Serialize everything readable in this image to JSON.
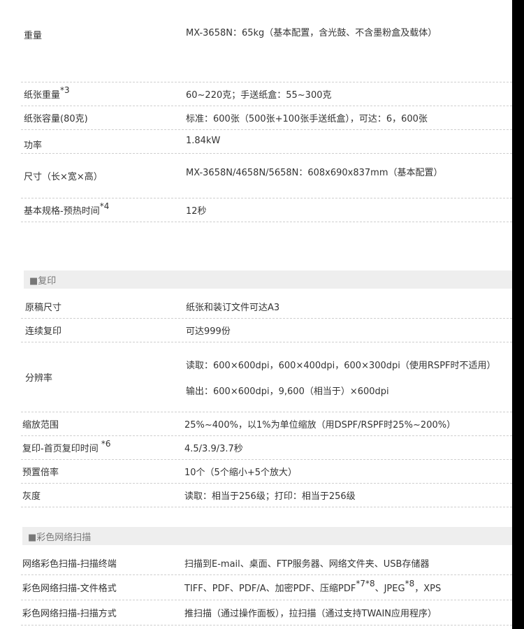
{
  "specs_top": [
    {
      "label": "重量",
      "value": "MX-3658N：65kg（基本配置，含光鼓、不含墨粉盒及载体）"
    },
    {
      "label": "纸张重量",
      "label_sup": "*3",
      "value": "60~220克；手送纸盒：55~300克"
    },
    {
      "label": "纸张容量(80克)",
      "value": "标准：600张（500张+100张手送纸盒），可达：6，600张"
    },
    {
      "label": "功率",
      "value": "1.84kW"
    },
    {
      "label": "尺寸（长×宽×高）",
      "value": "MX-3658N/4658N/5658N：608x690x837mm（基本配置）"
    },
    {
      "label": "基本规格-预热时间",
      "label_sup": "*4",
      "value": "12秒"
    }
  ],
  "section_copy": "■复印",
  "specs_copy": [
    {
      "label": "原稿尺寸",
      "value": "纸张和装订文件可达A3"
    },
    {
      "label": "连续复印",
      "value": "可达999份"
    },
    {
      "label": "分辨率",
      "value_lines": [
        "读取：600×600dpi，600×400dpi，600×300dpi（使用RSPF时不适用）",
        "输出：600×600dpi，9,600（相当于）×600dpi"
      ]
    },
    {
      "label": "缩放范围",
      "value": "25%~400%，以1%为单位缩放（用DSPF/RSPF时25%~200%）"
    },
    {
      "label": "复印-首页复印时间",
      "label_sup": "*6",
      "value": "4.5/3.9/3.7秒"
    },
    {
      "label": "预置倍率",
      "value": "10个（5个缩小+5个放大）"
    },
    {
      "label": "灰度",
      "value": "读取：相当于256级；打印：相当于256级"
    }
  ],
  "section_scan": "■彩色网络扫描",
  "specs_scan": [
    {
      "label": "网络彩色扫描-扫描终端",
      "value": "扫描到E-mail、桌面、FTP服务器、网络文件夹、USB存储器"
    },
    {
      "label": "彩色网络扫描-文件格式",
      "value_parts": [
        "TIFF、PDF、PDF/A、加密PDF、压缩PDF",
        "*7*8",
        "、JPEG",
        "*8",
        "，XPS"
      ]
    },
    {
      "label": "彩色网络扫描-扫描方式",
      "value": "推扫描（通过操作面板），拉扫描（通过支持TWAIN应用程序）"
    }
  ]
}
